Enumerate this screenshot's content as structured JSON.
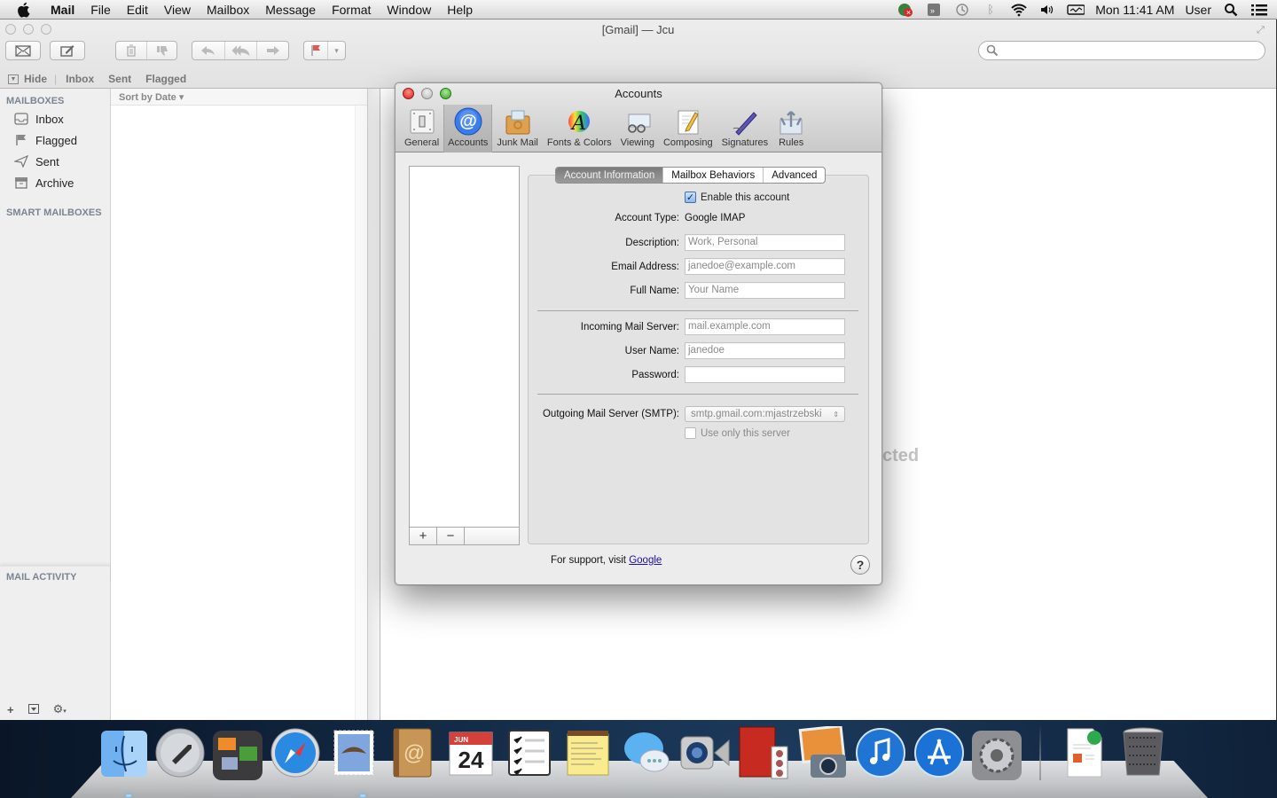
{
  "menubar": {
    "app_name": "Mail",
    "items": [
      "File",
      "Edit",
      "View",
      "Mailbox",
      "Message",
      "Format",
      "Window",
      "Help"
    ],
    "status_icons": [
      "crashplan-icon",
      "airplay-icon",
      "time-machine-icon",
      "bluetooth-icon",
      "wifi-icon",
      "volume-icon",
      "battery-icon"
    ],
    "clock": "Mon 11:41 AM",
    "user": "User"
  },
  "mail_window": {
    "title": "[Gmail] — Jcu",
    "toolbar": {
      "get_mail": "get-mail-icon",
      "compose": "compose-icon",
      "delete": "trash-icon",
      "junk": "thumbs-down-icon",
      "reply": "reply-icon",
      "reply_all": "reply-all-icon",
      "forward": "forward-icon",
      "flag": "flag-icon"
    },
    "search_placeholder": "",
    "favorites": {
      "hide": "Hide",
      "items": [
        "Inbox",
        "Sent",
        "Flagged"
      ]
    },
    "sidebar": {
      "mailboxes_header": "MAILBOXES",
      "mailboxes": [
        {
          "label": "Inbox",
          "icon": "inbox-icon"
        },
        {
          "label": "Flagged",
          "icon": "flag-icon"
        },
        {
          "label": "Sent",
          "icon": "paper-plane-icon"
        },
        {
          "label": "Archive",
          "icon": "archive-icon"
        }
      ],
      "smart_header": "SMART MAILBOXES",
      "activity_header": "MAIL ACTIVITY"
    },
    "list": {
      "sort_label": "Sort by Date ▾"
    },
    "message_pane": {
      "empty_text_fragment": "cted"
    }
  },
  "dialog": {
    "title": "Accounts",
    "tabs": [
      {
        "label": "General",
        "icon": "switch-icon"
      },
      {
        "label": "Accounts",
        "icon": "at-icon",
        "active": true
      },
      {
        "label": "Junk Mail",
        "icon": "junk-mail-icon"
      },
      {
        "label": "Fonts & Colors",
        "icon": "fonts-colors-icon"
      },
      {
        "label": "Viewing",
        "icon": "glasses-icon"
      },
      {
        "label": "Composing",
        "icon": "pencil-paper-icon"
      },
      {
        "label": "Signatures",
        "icon": "pen-icon"
      },
      {
        "label": "Rules",
        "icon": "rules-icon"
      }
    ],
    "segments": [
      "Account Information",
      "Mailbox Behaviors",
      "Advanced"
    ],
    "active_segment": "Account Information",
    "enable_account": {
      "label": "Enable this account",
      "checked": true
    },
    "fields": {
      "account_type": {
        "label": "Account Type:",
        "value": "Google IMAP"
      },
      "description": {
        "label": "Description:",
        "value": "",
        "placeholder": "Work, Personal"
      },
      "email": {
        "label": "Email Address:",
        "value": "",
        "placeholder": "janedoe@example.com"
      },
      "full_name": {
        "label": "Full Name:",
        "value": "",
        "placeholder": "Your Name"
      },
      "incoming_server": {
        "label": "Incoming Mail Server:",
        "value": "",
        "placeholder": "mail.example.com"
      },
      "user_name": {
        "label": "User Name:",
        "value": "",
        "placeholder": "janedoe"
      },
      "password": {
        "label": "Password:",
        "value": ""
      },
      "outgoing_server": {
        "label": "Outgoing Mail Server (SMTP):",
        "value": "smtp.gmail.com:mjastrzebski"
      }
    },
    "use_only_server": {
      "label": "Use only this server",
      "checked": false
    },
    "list_buttons": {
      "add": "+",
      "remove": "−"
    },
    "support_text": "For support, visit",
    "support_link": "Google",
    "help": "?"
  },
  "dock": {
    "items": [
      {
        "name": "finder",
        "label": "Finder",
        "running": true
      },
      {
        "name": "launchpad",
        "label": "Launchpad"
      },
      {
        "name": "mission-control",
        "label": "Mission Control"
      },
      {
        "name": "safari",
        "label": "Safari"
      },
      {
        "name": "mail",
        "label": "Mail",
        "running": true
      },
      {
        "name": "contacts",
        "label": "Contacts"
      },
      {
        "name": "calendar",
        "label": "Calendar",
        "month": "JUN",
        "day": "24"
      },
      {
        "name": "reminders",
        "label": "Reminders"
      },
      {
        "name": "notes",
        "label": "Notes"
      },
      {
        "name": "messages",
        "label": "Messages"
      },
      {
        "name": "facetime",
        "label": "FaceTime"
      },
      {
        "name": "photo-booth",
        "label": "Photo Booth"
      },
      {
        "name": "iphoto",
        "label": "iPhoto"
      },
      {
        "name": "itunes",
        "label": "iTunes"
      },
      {
        "name": "app-store",
        "label": "App Store"
      },
      {
        "name": "system-preferences",
        "label": "System Preferences"
      }
    ],
    "right_items": [
      {
        "name": "document",
        "label": "Document"
      },
      {
        "name": "trash",
        "label": "Trash"
      }
    ]
  }
}
